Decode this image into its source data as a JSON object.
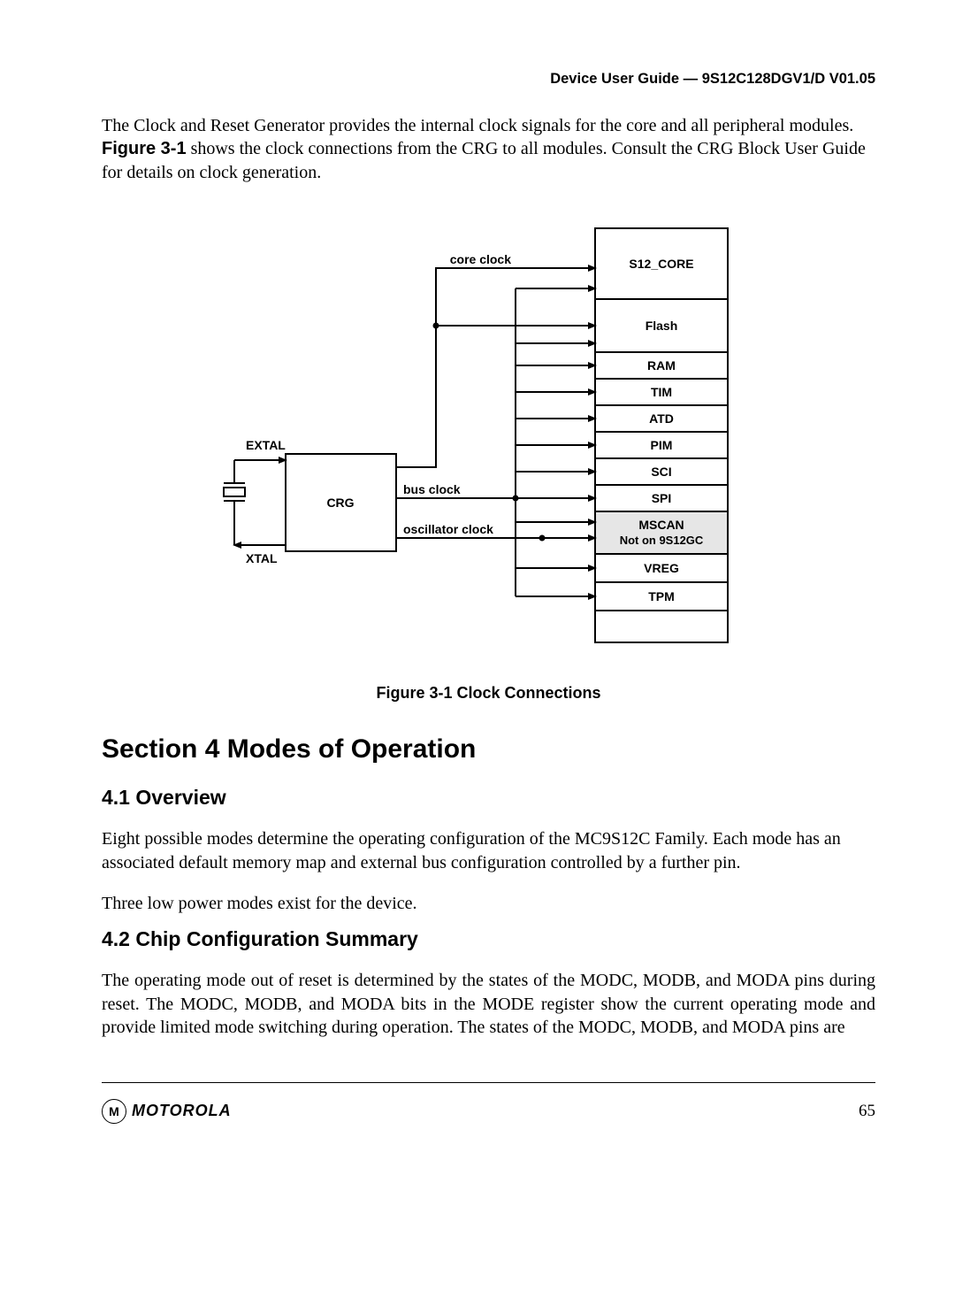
{
  "header": {
    "doc_title": "Device User Guide — 9S12C128DGV1/D V01.05"
  },
  "intro": {
    "sentence1": "The Clock and Reset Generator provides the internal clock signals for the core and all peripheral modules.",
    "figref": "Figure 3-1",
    "sentence2_rest": " shows the clock connections from the CRG to all modules. Consult the CRG Block User Guide for details on clock generation."
  },
  "diagram": {
    "extal": "EXTAL",
    "xtal": "XTAL",
    "crg": "CRG",
    "core_clock": "core clock",
    "bus_clock": "bus clock",
    "osc_clock": "oscillator clock",
    "blocks": {
      "s12_core": "S12_CORE",
      "flash": "Flash",
      "ram": "RAM",
      "tim": "TIM",
      "atd": "ATD",
      "pim": "PIM",
      "sci": "SCI",
      "spi": "SPI",
      "mscan": "MSCAN",
      "mscan_note": "Not on 9S12GC",
      "vreg": "VREG",
      "tpm": "TPM"
    }
  },
  "figure_caption": "Figure 3-1  Clock Connections",
  "section4": {
    "title": "Section 4  Modes of Operation",
    "s41_title": "4.1  Overview",
    "s41_p1": "Eight possible modes determine the operating configuration of the MC9S12C Family. Each mode has an associated default memory map and external bus configuration controlled by a further pin.",
    "s41_p2": "Three low power modes exist for the device.",
    "s42_title": "4.2  Chip Configuration Summary",
    "s42_p1": "The operating mode out of reset is determined by the states of the MODC, MODB, and MODA pins during reset. The MODC, MODB, and MODA bits in the MODE register show the current operating mode and provide limited mode switching during operation. The states of the MODC, MODB, and MODA pins are"
  },
  "footer": {
    "logo_m": "M",
    "logo_text": "MOTOROLA",
    "page": "65"
  }
}
